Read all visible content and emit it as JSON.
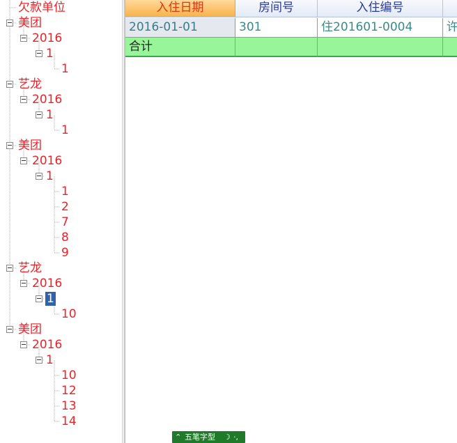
{
  "tree": {
    "nodes": [
      {
        "label": "欠款单位",
        "level": 0,
        "expander": false,
        "selected": false
      },
      {
        "label": "美团",
        "level": 0,
        "expander": true,
        "selected": false
      },
      {
        "label": "2016",
        "level": 1,
        "expander": true,
        "selected": false
      },
      {
        "label": "1",
        "level": 2,
        "expander": true,
        "selected": false
      },
      {
        "label": "1",
        "level": 3,
        "expander": false,
        "selected": false
      },
      {
        "label": "艺龙",
        "level": 0,
        "expander": true,
        "selected": false
      },
      {
        "label": "2016",
        "level": 1,
        "expander": true,
        "selected": false
      },
      {
        "label": "1",
        "level": 2,
        "expander": true,
        "selected": false
      },
      {
        "label": "1",
        "level": 3,
        "expander": false,
        "selected": false
      },
      {
        "label": "美团",
        "level": 0,
        "expander": true,
        "selected": false
      },
      {
        "label": "2016",
        "level": 1,
        "expander": true,
        "selected": false
      },
      {
        "label": "1",
        "level": 2,
        "expander": true,
        "selected": false
      },
      {
        "label": "1",
        "level": 3,
        "expander": false,
        "selected": false
      },
      {
        "label": "2",
        "level": 3,
        "expander": false,
        "selected": false
      },
      {
        "label": "7",
        "level": 3,
        "expander": false,
        "selected": false
      },
      {
        "label": "8",
        "level": 3,
        "expander": false,
        "selected": false
      },
      {
        "label": "9",
        "level": 3,
        "expander": false,
        "selected": false
      },
      {
        "label": "艺龙",
        "level": 0,
        "expander": true,
        "selected": false
      },
      {
        "label": "2016",
        "level": 1,
        "expander": true,
        "selected": false
      },
      {
        "label": "1",
        "level": 2,
        "expander": true,
        "selected": true
      },
      {
        "label": "10",
        "level": 3,
        "expander": false,
        "selected": false
      },
      {
        "label": "美团",
        "level": 0,
        "expander": true,
        "selected": false
      },
      {
        "label": "2016",
        "level": 1,
        "expander": true,
        "selected": false
      },
      {
        "label": "1",
        "level": 2,
        "expander": true,
        "selected": false
      },
      {
        "label": "10",
        "level": 3,
        "expander": false,
        "selected": false
      },
      {
        "label": "12",
        "level": 3,
        "expander": false,
        "selected": false
      },
      {
        "label": "13",
        "level": 3,
        "expander": false,
        "selected": false
      },
      {
        "label": "14",
        "level": 3,
        "expander": false,
        "selected": false
      }
    ]
  },
  "grid": {
    "columns": [
      "入住日期",
      "房间号",
      "入住编号",
      ""
    ],
    "active_column": 0,
    "rows": [
      [
        "2016-01-01",
        "301",
        "住201601-0004",
        "许"
      ]
    ],
    "total_row": [
      "合计",
      "",
      "",
      ""
    ]
  },
  "ime": {
    "label": "五笔字型",
    "icon_left": "double-chevron-up-icon",
    "icon_moon": "half-moon-icon",
    "icon_punct": "punctuation-icon"
  },
  "colors": {
    "tree_text": "#e8242a",
    "selection": "#3462a9",
    "header_active": "#f7b24a",
    "total_row": "#99f59a",
    "ime_bar": "#1f7a2a"
  }
}
